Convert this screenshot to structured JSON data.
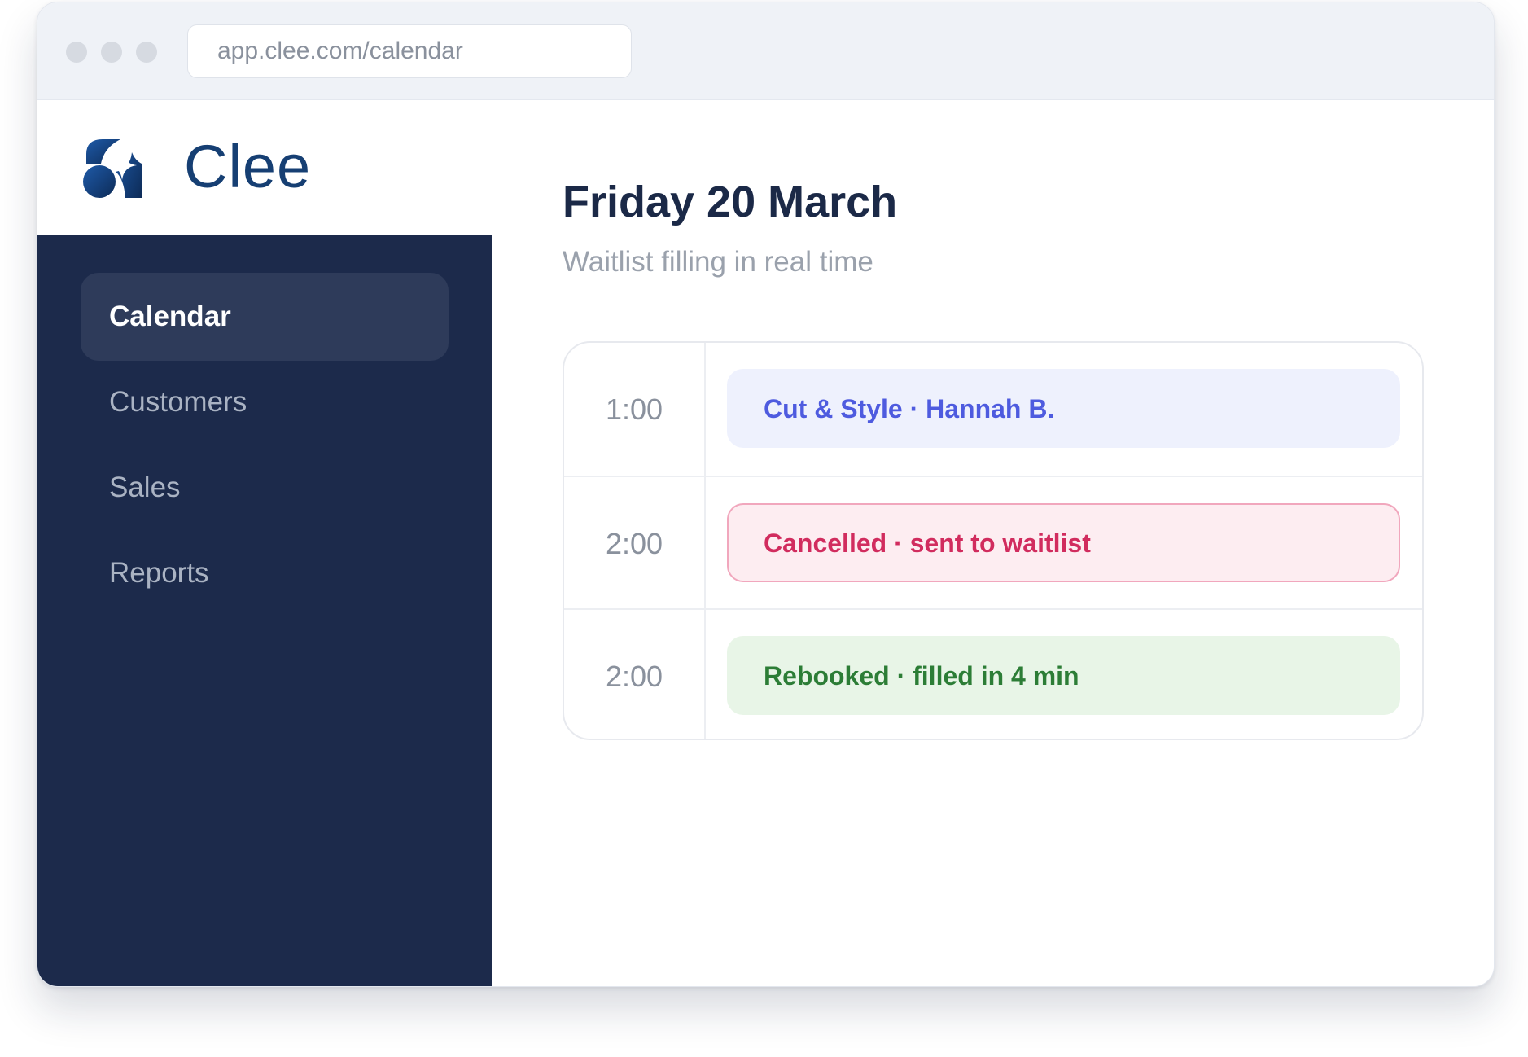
{
  "browser": {
    "url": "app.clee.com/calendar"
  },
  "brand": {
    "name": "Clee",
    "logo_icon": "clee-logo-icon"
  },
  "sidebar": {
    "items": [
      {
        "label": "Calendar",
        "active": true
      },
      {
        "label": "Customers",
        "active": false
      },
      {
        "label": "Sales",
        "active": false
      },
      {
        "label": "Reports",
        "active": false
      }
    ]
  },
  "main": {
    "title": "Friday 20 March",
    "subtitle": "Waitlist filling in real time",
    "schedule": [
      {
        "time": "1:00",
        "event": "Cut & Style · Hannah B.",
        "status": "booked",
        "color": "#4e5bdf"
      },
      {
        "time": "2:00",
        "event": "Cancelled · sent to waitlist",
        "status": "cancelled",
        "color": "#d12c5e"
      },
      {
        "time": "2:00",
        "event": "Rebooked · filled in 4 min",
        "status": "rebooked",
        "color": "#2c7d36"
      }
    ]
  },
  "colors": {
    "sidebar_bg": "#1c2a4b",
    "brand": "#163f73",
    "title": "#1b2947"
  }
}
